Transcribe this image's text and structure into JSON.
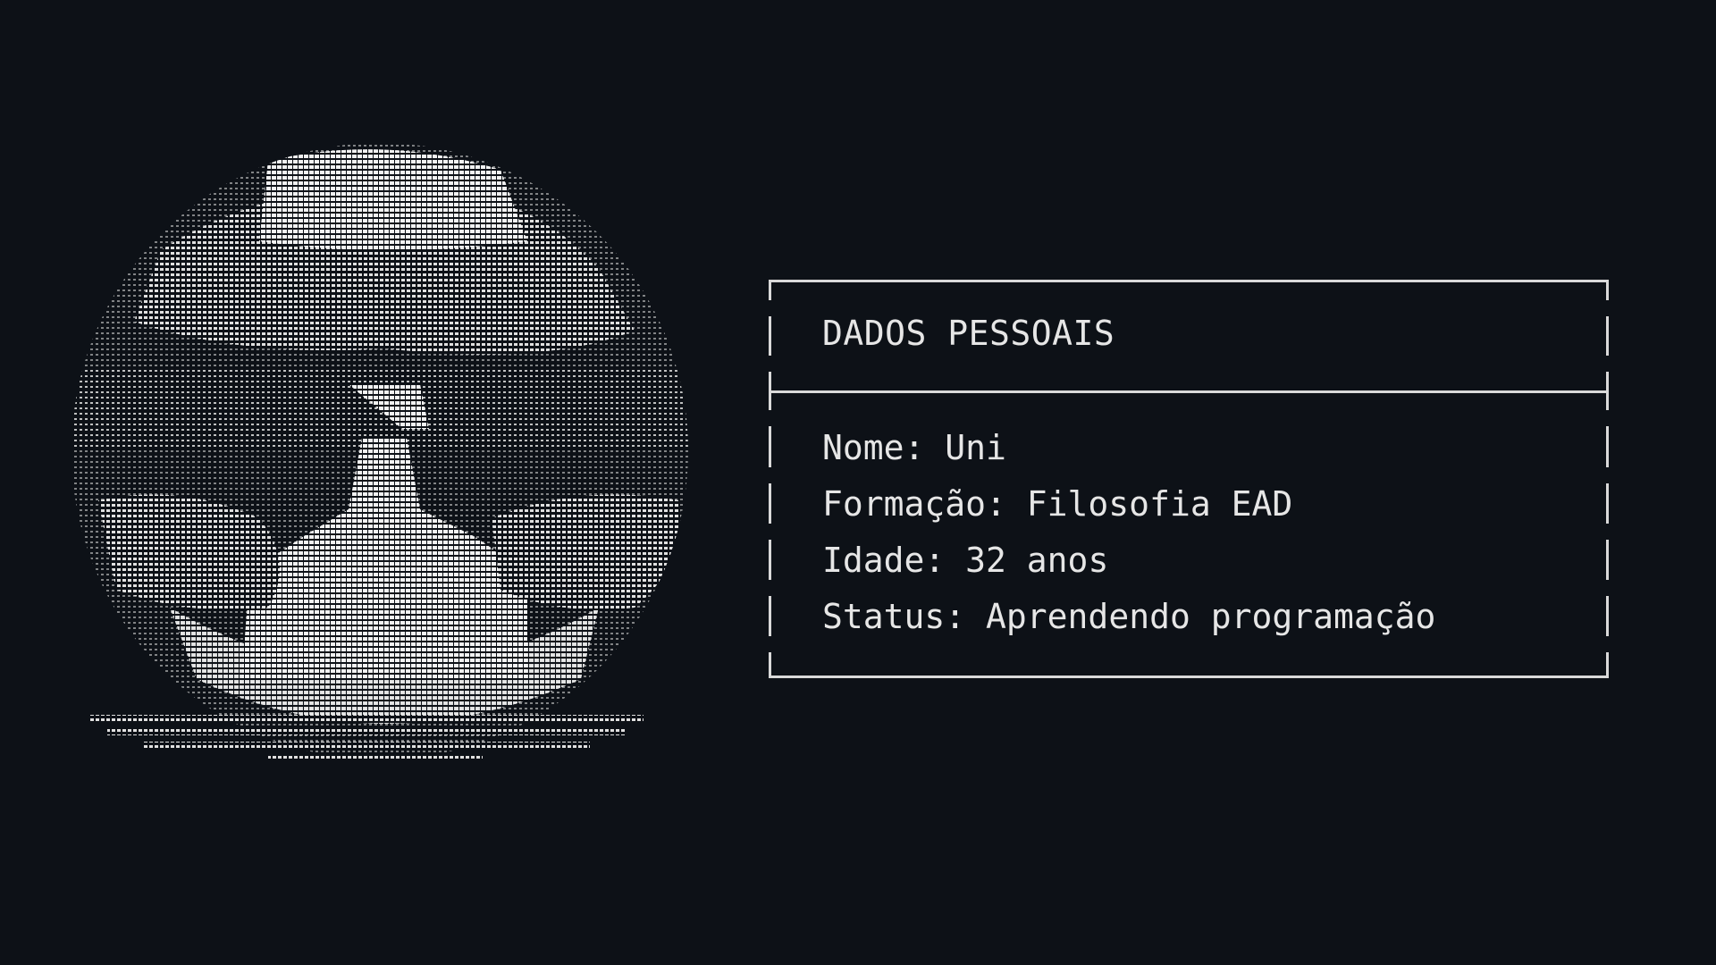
{
  "card": {
    "title": "DADOS PESSOAIS",
    "rows": [
      {
        "label": "Nome:",
        "value": "Uni"
      },
      {
        "label": "Formação:",
        "value": "Filosofia EAD"
      },
      {
        "label": "Idade:",
        "value": "32 anos"
      },
      {
        "label": "Status:",
        "value": "Aprendendo programação"
      }
    ]
  },
  "colors": {
    "background": "#0d1117",
    "text": "#e6e6e6",
    "border": "#d9d9d9"
  }
}
